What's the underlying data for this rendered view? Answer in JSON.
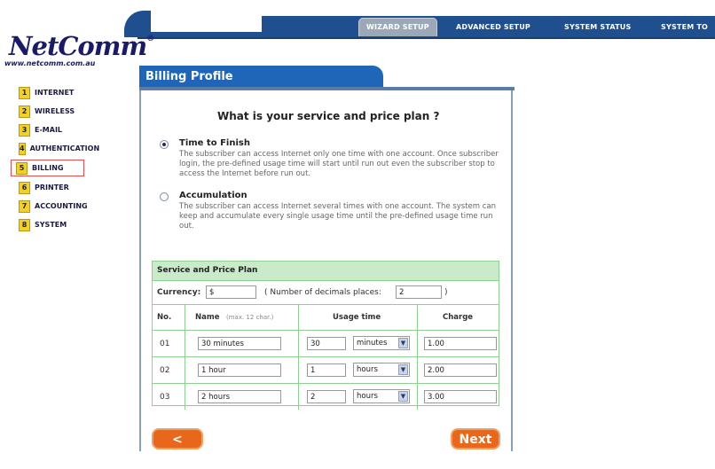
{
  "brand": {
    "logo": "NetComm",
    "url": "www.netcomm.com.au"
  },
  "nav": {
    "tabs": [
      {
        "label": "WIZARD SETUP",
        "active": true
      },
      {
        "label": "ADVANCED SETUP",
        "active": false
      },
      {
        "label": "SYSTEM STATUS",
        "active": false
      },
      {
        "label": "SYSTEM TO",
        "active": false
      }
    ]
  },
  "sidebar": {
    "items": [
      {
        "num": "1",
        "label": "INTERNET"
      },
      {
        "num": "2",
        "label": "WIRELESS"
      },
      {
        "num": "3",
        "label": "E-MAIL"
      },
      {
        "num": "4",
        "label": "AUTHENTICATION"
      },
      {
        "num": "5",
        "label": "BILLING",
        "selected": true
      },
      {
        "num": "6",
        "label": "PRINTER"
      },
      {
        "num": "7",
        "label": "ACCOUNTING"
      },
      {
        "num": "8",
        "label": "SYSTEM"
      }
    ]
  },
  "panel": {
    "title": "Billing Profile",
    "question": "What is your service and price plan ?",
    "options": [
      {
        "title": "Time to Finish",
        "checked": true,
        "desc": "The subscriber can access Internet only one time with one account. Once subscriber login, the pre-defined usage time will start until run out even the subscriber stop to access the Internet before run out."
      },
      {
        "title": "Accumulation",
        "checked": false,
        "desc": "The subscriber can access Internet several times with one account. The system can keep and accumulate every single usage time until the pre-defined usage time run out."
      }
    ]
  },
  "plan": {
    "heading": "Service and Price Plan",
    "currency_label": "Currency:",
    "currency_value": "$",
    "decimals_prefix": "( Number of decimals places:",
    "decimals_value": "2",
    "decimals_suffix": ")",
    "columns": {
      "no": "No.",
      "name": "Name",
      "name_hint": "(max. 12 char.)",
      "usage": "Usage time",
      "charge": "Charge"
    },
    "rows": [
      {
        "no": "01",
        "name": "30 minutes",
        "usage": "30",
        "unit": "minutes",
        "charge": "1.00"
      },
      {
        "no": "02",
        "name": "1 hour",
        "usage": "1",
        "unit": "hours",
        "charge": "2.00"
      },
      {
        "no": "03",
        "name": "2 hours",
        "usage": "2",
        "unit": "hours",
        "charge": "3.00"
      }
    ]
  },
  "buttons": {
    "back": "< Back",
    "next": "Next >"
  },
  "colors": {
    "accent": "#1f66b8",
    "button": "#e8671a",
    "table_border": "#8fcf8f",
    "table_header": "#c9ebc9",
    "menu_num": "#f3d027"
  }
}
